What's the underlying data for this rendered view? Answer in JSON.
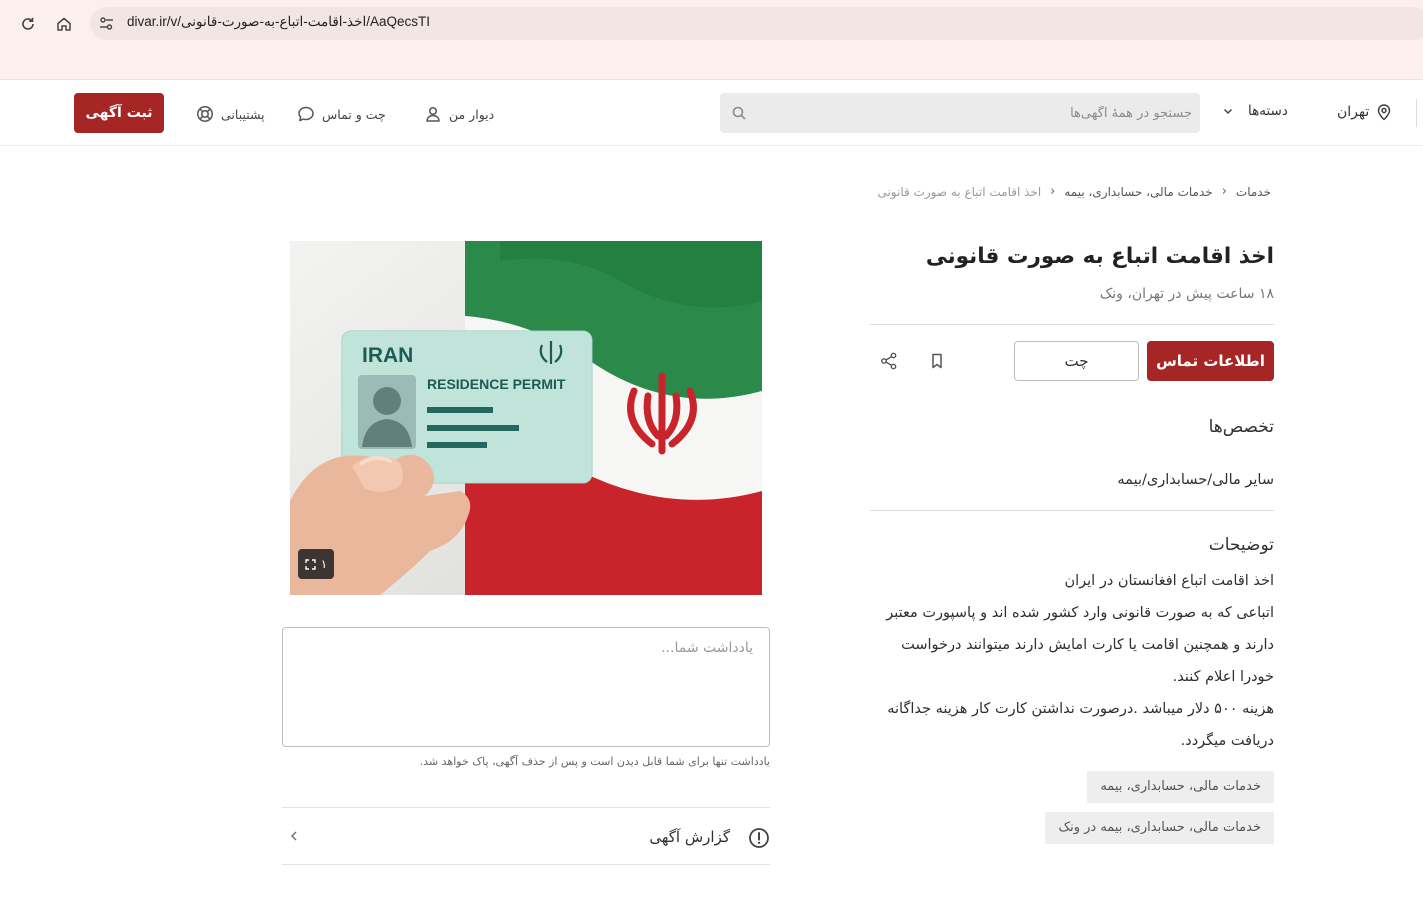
{
  "browser": {
    "url": "divar.ir/v/اخذ-اقامت-اتباع-به-صورت-قانونی/AaQecsTI"
  },
  "header": {
    "post_button": "ثبت آگهی",
    "support": "پشتیبانی",
    "chat": "چت و تماس",
    "my_divar": "دیوار من",
    "search_placeholder": "جستجو در همهٔ آگهی‌ها",
    "categories": "دسته‌ها",
    "city": "تهران"
  },
  "breadcrumb": [
    "خدمات",
    "خدمات مالی، حسابداری، بیمه",
    "اخذ اقامت اتباع به صورت قانونی"
  ],
  "ad": {
    "title": "اخذ اقامت اتباع به صورت قانونی",
    "subtitle": "۱۸ ساعت پیش در تهران، ونک",
    "contact_button": "اطلاعات تماس",
    "chat_button": "چت",
    "specialties_title": "تخصص‌ها",
    "specialty_value": "سایر مالی/حسابداری/بیمه",
    "description_title": "توضیحات",
    "description_lines": [
      "اخذ اقامت اتباع افغانستان در ایران",
      "اتباعی که به صورت قانونی وارد کشور شده اند و پاسپورت معتبر",
      "دارند و همچنین اقامت یا کارت امایش دارند میتوانند درخواست",
      "خودرا اعلام کنند.",
      "هزینه ۵۰۰ دلار میباشد .درصورت نداشتن کارت کار هزینه جداگانه",
      "دریافت میگردد."
    ],
    "tags": [
      "خدمات مالی، حسابداری، بیمه",
      "خدمات مالی، حسابداری، بیمه در ونک"
    ]
  },
  "gallery": {
    "count": "۱",
    "card_country": "IRAN",
    "card_title": "RESIDENCE PERMIT"
  },
  "note": {
    "placeholder": "یادداشت شما...",
    "hint": "یادداشت تنها برای شما قابل دیدن است و پس از حذف آگهی، پاک خواهد شد."
  },
  "report": {
    "label": "گزارش آگهی"
  },
  "colors": {
    "brand": "#a62626"
  }
}
